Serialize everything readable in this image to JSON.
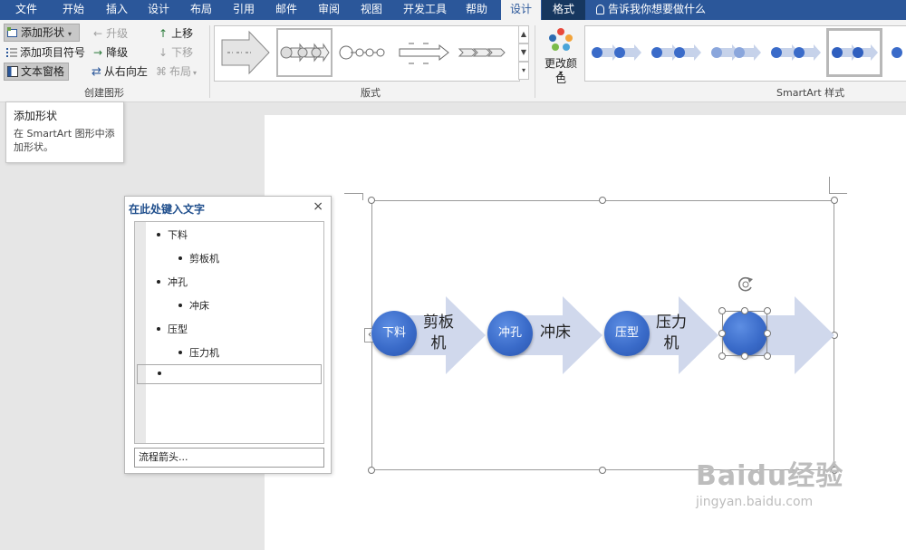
{
  "menubar": {
    "tabs": [
      "文件",
      "开始",
      "插入",
      "设计",
      "布局",
      "引用",
      "邮件",
      "审阅",
      "视图",
      "开发工具",
      "帮助"
    ],
    "context_tabs": {
      "design": "设计",
      "format": "格式"
    },
    "tell_me": "告诉我你想要做什么"
  },
  "ribbon": {
    "create_group": {
      "add_shape": "添加形状",
      "add_bullet": "添加项目符号",
      "text_pane": "文本窗格",
      "promote": "升级",
      "demote": "降级",
      "right_to_left": "从右向左",
      "move_up": "上移",
      "move_down": "下移",
      "layout": "布局",
      "label": "创建图形"
    },
    "layouts_group": {
      "label": "版式"
    },
    "styles_group": {
      "change_colors": "更改颜色",
      "label": "SmartArt 样式"
    }
  },
  "tooltip": {
    "title": "添加形状",
    "body": "在 SmartArt 图形中添加形状。"
  },
  "text_pane": {
    "title": "在此处键入文字",
    "close": "×",
    "items": [
      {
        "level": 1,
        "text": "下料"
      },
      {
        "level": 2,
        "text": "剪板机"
      },
      {
        "level": 1,
        "text": "冲孔"
      },
      {
        "level": 2,
        "text": "冲床"
      },
      {
        "level": 1,
        "text": "压型"
      },
      {
        "level": 2,
        "text": "压力机"
      },
      {
        "level": 1,
        "text": ""
      }
    ],
    "footer": "流程箭头..."
  },
  "smartart": {
    "steps": [
      {
        "circle": "下料",
        "arrow": "剪板机"
      },
      {
        "circle": "冲孔",
        "arrow": "冲床"
      },
      {
        "circle": "压型",
        "arrow": "压力机"
      },
      {
        "circle": "",
        "arrow": ""
      }
    ],
    "colors": {
      "circle": "#3a6bc9",
      "arrow": "#d0d8ec"
    }
  },
  "watermark": {
    "main": "Baidu经验",
    "sub": "jingyan.baidu.com"
  }
}
